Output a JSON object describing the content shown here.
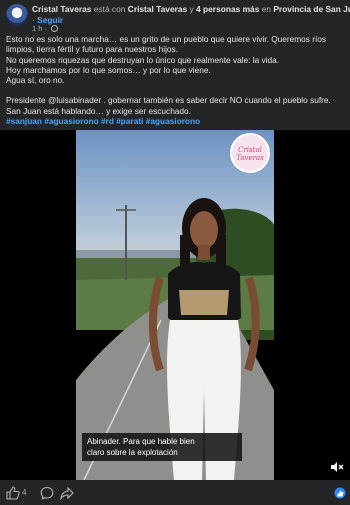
{
  "header": {
    "author": "Cristal Taveras",
    "connector_1": "está con",
    "tagged": "Cristal Taveras",
    "connector_2": "y",
    "others": "4 personas más",
    "connector_3": "en",
    "location": "Provincia de San Juan.",
    "follow_label": "Seguir",
    "time": "1 h",
    "privacy_icon": "globe-icon"
  },
  "post": {
    "line1": "Esto no es solo una marcha… es un grito de un pueblo que quiere vivir. Queremos ríos limpios, tierra fértil y futuro para nuestros hijos.",
    "line2": "No queremos riquezas que destruyan lo único que realmente vale: la vida.",
    "line3": "Hoy marchamos por lo que somos… y por lo que viene.",
    "line4": "Agua sí, oro no.",
    "line5": "Presidente @luisabinader . gobernar también es saber decir NO cuando el pueblo sufre.",
    "line6": "San Juan está hablando… y exige ser escuchado.",
    "hashtags": "#sanjuan #aguasiorono #rd #parati #aguasiorono"
  },
  "video": {
    "logo_text_1": "Cristal",
    "logo_text_2": "Taveras",
    "caption_line1": "Abinader. Para que hable bien",
    "caption_line2": "claro sobre la explotación",
    "mute_icon": "speaker-muted-icon"
  },
  "footer": {
    "like_count": "4",
    "icons": [
      "like-icon",
      "comment-icon",
      "share-icon",
      "emoji-icon"
    ]
  }
}
